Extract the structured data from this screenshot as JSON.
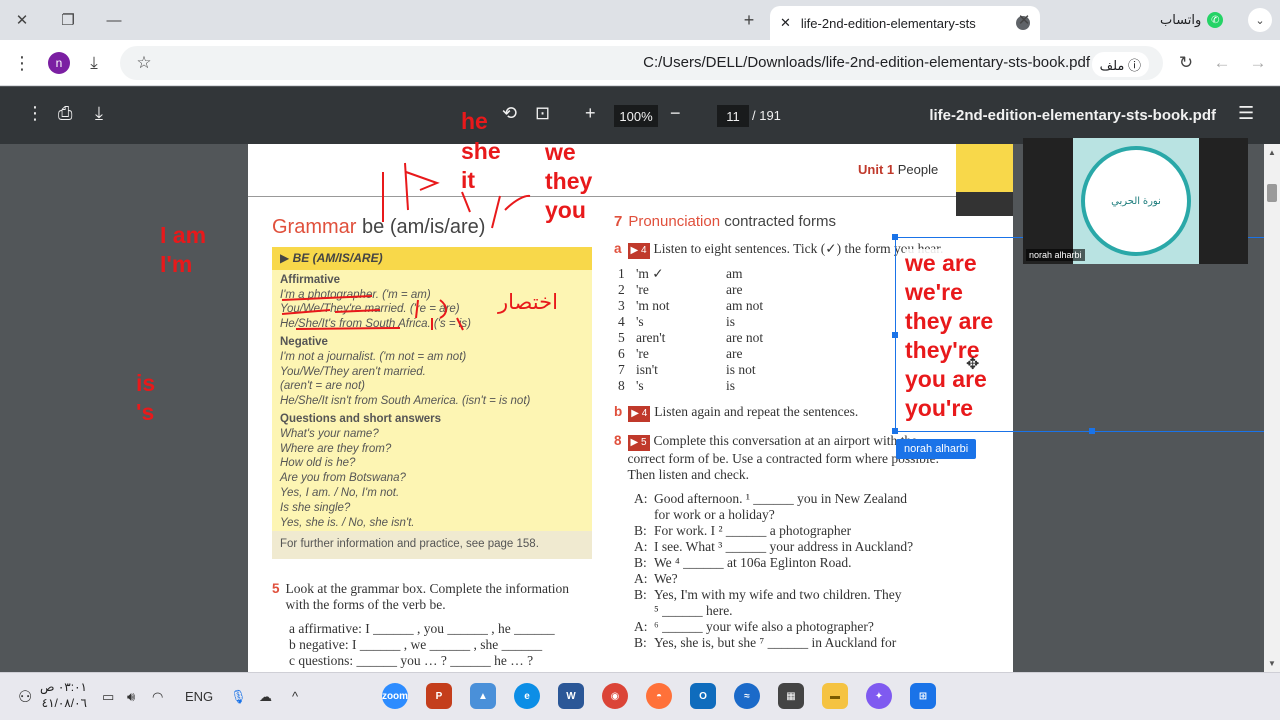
{
  "browser": {
    "tab_title": "life-2nd-edition-elementary-sts",
    "whatsapp_label": "واتساب",
    "url": "C:/Users/DELL/Downloads/life-2nd-edition-elementary-sts-book.pdf",
    "file_chip": "ملف",
    "avatar_letter": "n"
  },
  "pdf": {
    "zoom": "100%",
    "page": "11",
    "page_total": "/ 191",
    "title": "life-2nd-edition-elementary-sts-book.pdf"
  },
  "page": {
    "unit_label": "Unit 1",
    "unit_name": "People",
    "grammar_word": "Grammar",
    "grammar_rest": "be (am/is/are)",
    "box_header": "BE (AM/IS/ARE)",
    "affirmative_h": "Affirmative",
    "aff1": "I'm a photographer. ('m = am)",
    "aff2": "You/We/They're married. ('re = are)",
    "aff3": "He/She/It's from South Africa. ('s = is)",
    "negative_h": "Negative",
    "neg1": "I'm not a journalist. ('m not = am not)",
    "neg2": "You/We/They aren't married.",
    "neg3": "(aren't = are not)",
    "neg4": "He/She/It isn't from South America. (isn't = is not)",
    "questions_h": "Questions and short answers",
    "q1": "What's your name?",
    "q2": "Where are they from?",
    "q3": "How old is he?",
    "q4": "Are you from Botswana?",
    "q5": "Yes, I am. / No, I'm not.",
    "q6": "Is she single?",
    "q7": "Yes, she is. / No, she isn't.",
    "foot": "For further information and practice, see page 158.",
    "ex5_num": "5",
    "ex5_text": "Look at the grammar box. Complete the information with the forms of the verb be.",
    "ex5_a": "a   affirmative: I ______ , you ______ , he ______",
    "ex5_b": "b   negative: I ______ , we ______ , she ______",
    "ex5_c": "c   questions: ______ you … ? ______ he … ?",
    "ex7_num": "7",
    "ex7_title_a": "Pronunciation",
    "ex7_title_b": "contracted forms",
    "ex7a_letter": "a",
    "ex7a_track": "4",
    "ex7a_text": "Listen to eight sentences. Tick (✓) the form you hear.",
    "pairs": [
      {
        "n": "1",
        "c": "'m ✓",
        "f": "am"
      },
      {
        "n": "2",
        "c": "'re",
        "f": "are"
      },
      {
        "n": "3",
        "c": "'m not",
        "f": "am not"
      },
      {
        "n": "4",
        "c": "'s",
        "f": "is"
      },
      {
        "n": "5",
        "c": "aren't",
        "f": "are not"
      },
      {
        "n": "6",
        "c": "'re",
        "f": "are"
      },
      {
        "n": "7",
        "c": "isn't",
        "f": "is not"
      },
      {
        "n": "8",
        "c": "'s",
        "f": "is"
      }
    ],
    "ex7b_letter": "b",
    "ex7b_track": "4",
    "ex7b_text": "Listen again and repeat the sentences.",
    "ex8_num": "8",
    "ex8_track": "5",
    "ex8_text": "Complete this conversation at an airport with the correct form of be. Use a contracted form where possible. Then listen and check.",
    "dialogue": [
      {
        "s": "A:",
        "t": "Good afternoon. ¹ ______ you in New Zealand"
      },
      {
        "s": "",
        "t": "for work or a holiday?"
      },
      {
        "s": "B:",
        "t": "For work. I ² ______ a photographer"
      },
      {
        "s": "A:",
        "t": "I see. What ³ ______ your address in Auckland?"
      },
      {
        "s": "B:",
        "t": "We ⁴ ______ at 106a Eglinton Road."
      },
      {
        "s": "A:",
        "t": "We?"
      },
      {
        "s": "B:",
        "t": "Yes, I'm with my wife and two children. They"
      },
      {
        "s": "",
        "t": "⁵ ______ here."
      },
      {
        "s": "A:",
        "t": "⁶ ______ your wife also a photographer?"
      },
      {
        "s": "B:",
        "t": "Yes, she is, but she ⁷ ______ in Auckland for"
      }
    ]
  },
  "annotations": {
    "he": "he",
    "she": "she",
    "it": "it",
    "we": "we",
    "they": "they",
    "you": "you",
    "i_am": "I am",
    "i_m": "I'm",
    "is": "is",
    "s": "'s",
    "arabic": "اختصار",
    "box_lines": [
      "we are",
      "we're",
      "they are",
      "they're",
      "you are",
      "you're"
    ]
  },
  "meeting": {
    "user": "norah alharbi",
    "video_label": "norah alharbi",
    "logo_text": "نورة الحربي"
  },
  "taskbar": {
    "time": "٠٣:٠١ ص",
    "date": "٤١/٠٨/٠٦",
    "lang": "ENG"
  },
  "colors": {
    "annotation": "#e8191b",
    "accent": "#1a73e8",
    "book_red": "#e0503c"
  }
}
